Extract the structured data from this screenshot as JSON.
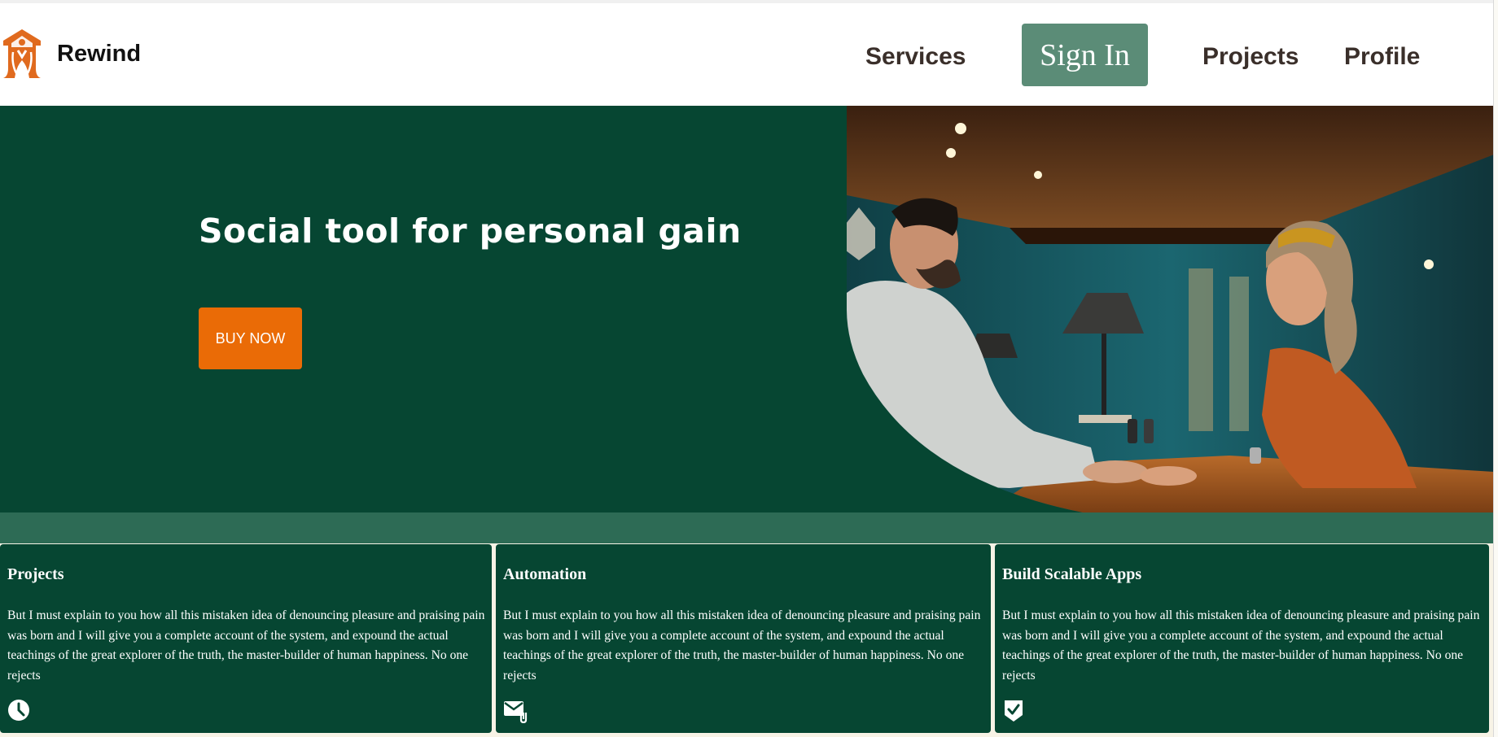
{
  "header": {
    "brand_name": "Rewind",
    "nav": {
      "services": "Services",
      "sign_in": "Sign In",
      "projects": "Projects",
      "profile": "Profile"
    }
  },
  "hero": {
    "title": "Social tool for personal gain",
    "cta_label": "BUY NOW",
    "image_alt": "Couple holding hands at a restaurant table"
  },
  "cards": [
    {
      "title": "Projects",
      "body": "But I must explain to you how all this mistaken idea of denouncing pleasure and praising pain was born and I will give you a complete account of the system, and expound the actual teachings of the great explorer of the truth, the master-builder of human happiness. No one rejects",
      "icon": "clock-icon"
    },
    {
      "title": "Automation",
      "body": "But I must explain to you how all this mistaken idea of denouncing pleasure and praising pain was born and I will give you a complete account of the system, and expound the actual teachings of the great explorer of the truth, the master-builder of human happiness. No one rejects",
      "icon": "mail-attachment-icon"
    },
    {
      "title": "Build Scalable Apps",
      "body": "But I must explain to you how all this mistaken idea of denouncing pleasure and praising pain was born and I will give you a complete account of the system, and expound the actual teachings of the great explorer of the truth, the master-builder of human happiness. No one rejects",
      "icon": "shield-check-icon"
    }
  ],
  "colors": {
    "primary_dark_green": "#064632",
    "strip_green": "#2d6b55",
    "signin_green": "#5b8c77",
    "accent_orange": "#ea6b06",
    "nav_text": "#3a2f2a"
  }
}
